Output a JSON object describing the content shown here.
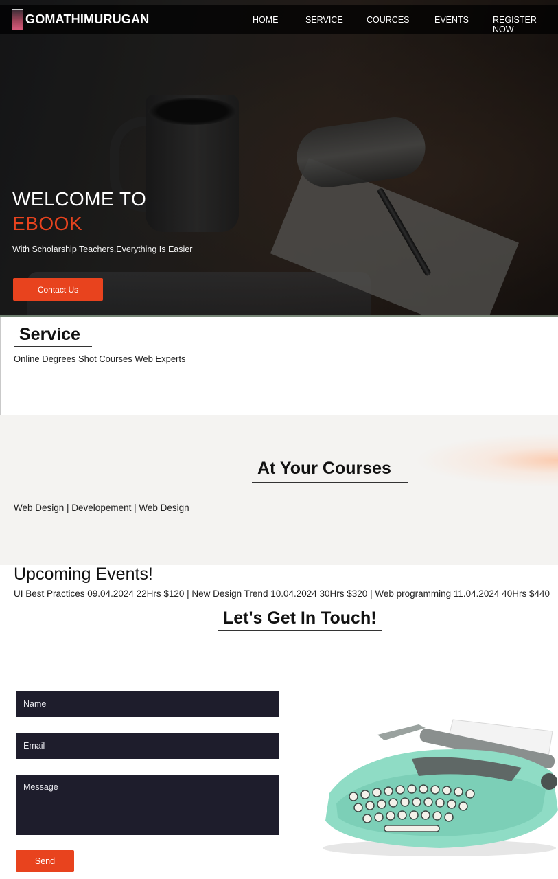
{
  "brand": {
    "name": "GOMATHIMURUGAN",
    "avatar_icon": "profile-photo"
  },
  "nav": [
    "HOME",
    "SERVICE",
    "COURCES",
    "EVENTS",
    "REGISTER NOW"
  ],
  "hero": {
    "title": "WELCOME TO",
    "accent": "EBOOK",
    "subtitle": "With Scholarship Teachers,Everything Is Easier",
    "cta": "Contact Us"
  },
  "service": {
    "title": "Service",
    "items": "Online Degrees Shot Courses Web Experts"
  },
  "courses": {
    "title": "At Your Courses",
    "items": "Web Design | Developement | Web Design"
  },
  "events": {
    "title": "Upcoming Events!",
    "items": "UI Best Practices 09.04.2024 22Hrs $120 | New Design Trend 10.04.2024 30Hrs $320 | Web programming 11.04.2024 40Hrs $440"
  },
  "contact": {
    "title": "Let's Get In Touch!",
    "name_placeholder": "Name",
    "email_placeholder": "Email",
    "message_placeholder": "Message",
    "send": "Send"
  },
  "colors": {
    "accent": "#e8431e",
    "field_bg": "#1e1d2c",
    "nav_bg": "#000000"
  }
}
